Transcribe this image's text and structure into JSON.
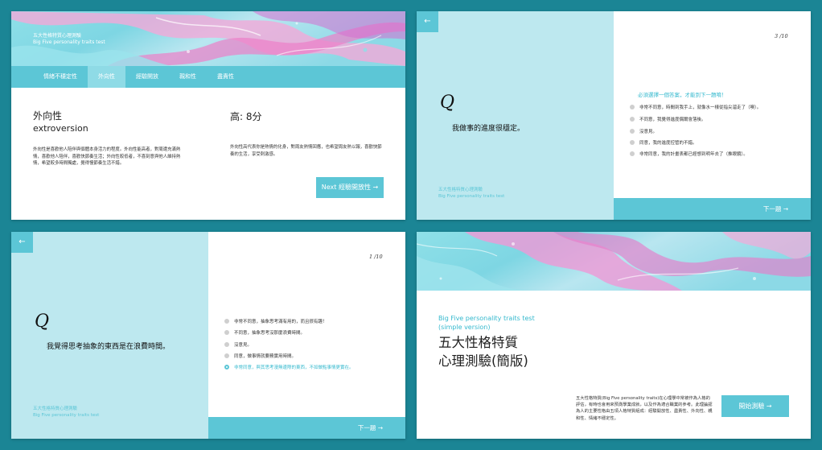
{
  "result_card": {
    "brand_zh": "五大性格特質心理測驗",
    "brand_en": "Big Five personality traits test",
    "tabs": [
      "情緒不穩定性",
      "外向性",
      "經驗開放",
      "親和性",
      "盡責性"
    ],
    "active_tab": "外向性",
    "trait_zh": "外向性",
    "trait_en": "extroversion",
    "score_text": "高: 8分",
    "trait_description": "外向性是喜歡他人陪伴與個體本身活力的程度。外向性能高者，對周遭充滿熱情，喜歡他人陪伴，喜歡快節奏生活；外向性較低者，不喜刻意與他人維持熱情，希望較多時間獨處，覺得慢節奏生活不錯。",
    "score_description": "外向性高代表你是熱情的化身，對周友熱情回應，也希望周友熱以報，喜歡快節奏的生活，享受刺激感。",
    "next_button": "Next 經驗開放性 →"
  },
  "question_card_3": {
    "counter": "3 /10",
    "q_mark": "Q",
    "question": "我做事的進度很穩定。",
    "warning": "必須選擇一個答案，才能到下一題唷！",
    "options": [
      "非常不同意，時間到我手上，就像水一樣從指尖溜走了（噢）。",
      "不同意，我覺得進度偶爾會落後。",
      "沒意見。",
      "同意，我的進度控管的不錯。",
      "非常同意，我的計畫表都已經想到明年去了（推眼鏡）。"
    ],
    "selected_index": -1,
    "brand_zh": "五大性格特質心理測驗",
    "brand_en": "Big Five personality traits test",
    "next_label": "下一題 →",
    "back_icon": "←"
  },
  "question_card_1": {
    "counter": "1 /10",
    "q_mark": "Q",
    "question": "我覺得思考抽象的東西是在浪費時間。",
    "options": [
      "非常不同意，抽象思考滿有用的，而且很有趣！",
      "不同意，抽象思考沒那麼浪費時間。",
      "沒意見。",
      "同意，做事情就要務實用時間。",
      "非常同意，與其思考漫無邊際的東西，不如做點事情更實在。"
    ],
    "selected_index": 4,
    "brand_zh": "五大性格特質心理測驗",
    "brand_en": "Big Five personality traits test",
    "next_label": "下一題 →",
    "back_icon": "←"
  },
  "intro_card": {
    "title_en_line1": "Big Five personality traits test",
    "title_en_line2": "(simple version)",
    "title_zh_line1": "五大性格特質",
    "title_zh_line2": "心理測驗(簡版)",
    "description": "五大性格特質(Big Five personality traits)在心理學中常被作為人格的評估，有時也會用來預測學業成就，以及作為適合職業的參考。此理論認為人的主要性格由五項人格特質組成：經驗開放性、盡責性、外向性、親和性、情緒不穩定性。",
    "start_button": "開始測驗 →"
  },
  "colors": {
    "page_background": "#1b8595",
    "accent": "#5cc6d6",
    "accent_light": "#bde8ef",
    "accent_text": "#35b9ce"
  }
}
